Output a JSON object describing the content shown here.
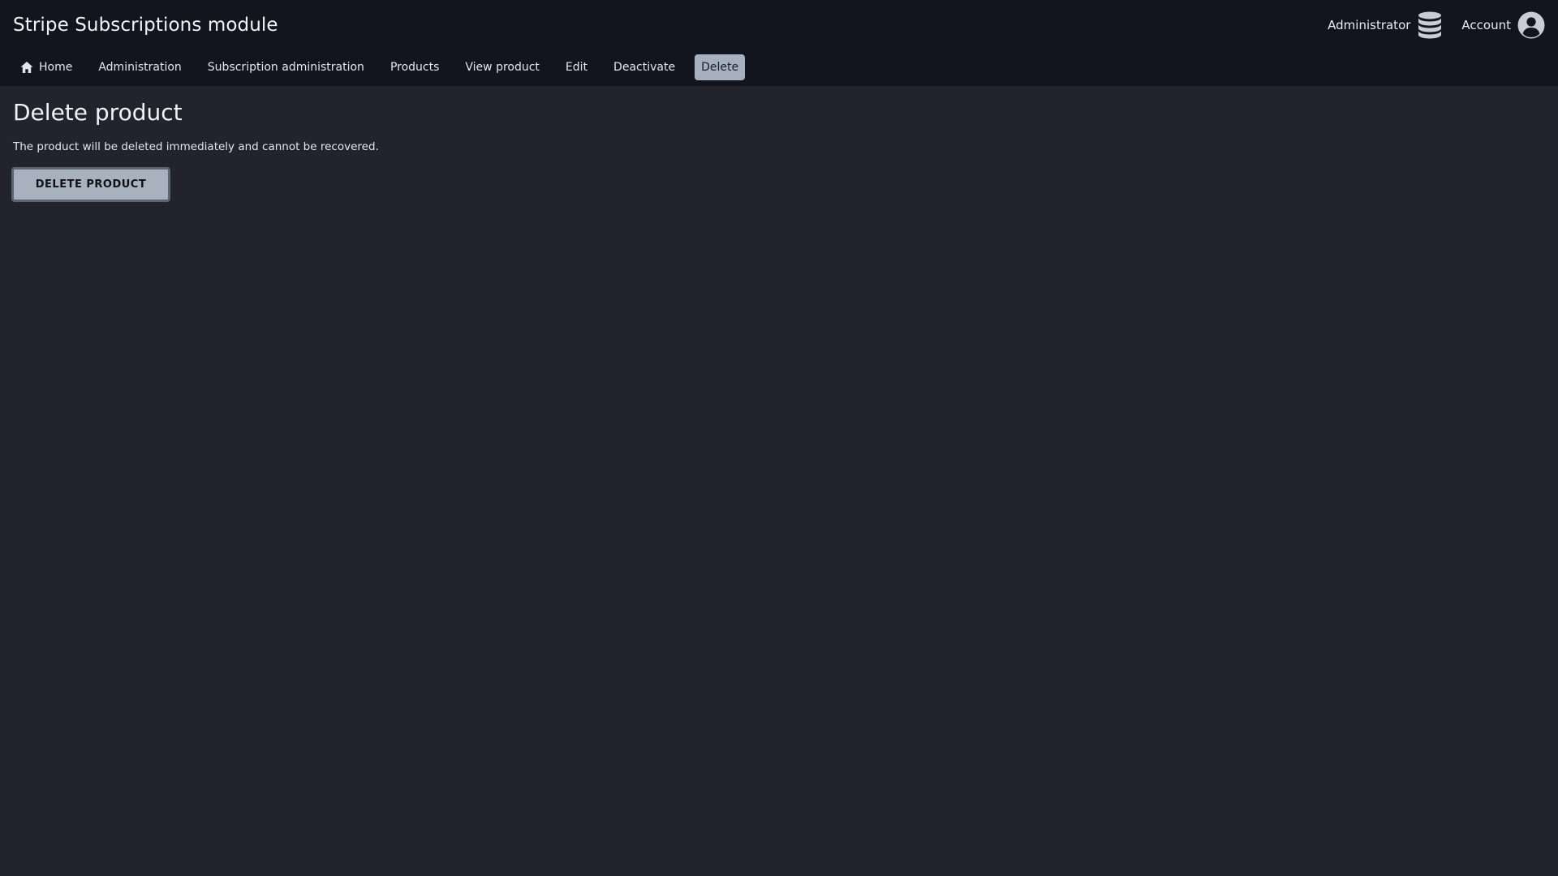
{
  "app": {
    "title": "Stripe Subscriptions module"
  },
  "user_menu": {
    "administrator_label": "Administrator",
    "administrator_icon": "database-icon",
    "account_label": "Account",
    "account_icon": "user-circle-icon"
  },
  "nav": {
    "items": [
      {
        "label": "Home",
        "icon": "home-icon"
      },
      {
        "label": "Administration"
      },
      {
        "label": "Subscription administration"
      },
      {
        "label": "Products"
      },
      {
        "label": "View product"
      },
      {
        "label": "Edit"
      },
      {
        "label": "Deactivate"
      },
      {
        "label": "Delete",
        "active": true
      }
    ]
  },
  "main": {
    "title": "Delete product",
    "description": "The product will be deleted immediately and cannot be recovered.",
    "delete_button_label": "DELETE PRODUCT"
  },
  "colors": {
    "background": "#22232c",
    "header_background": "#13141d",
    "active_tab": "#a7b0be",
    "button": "#a8b1be"
  }
}
